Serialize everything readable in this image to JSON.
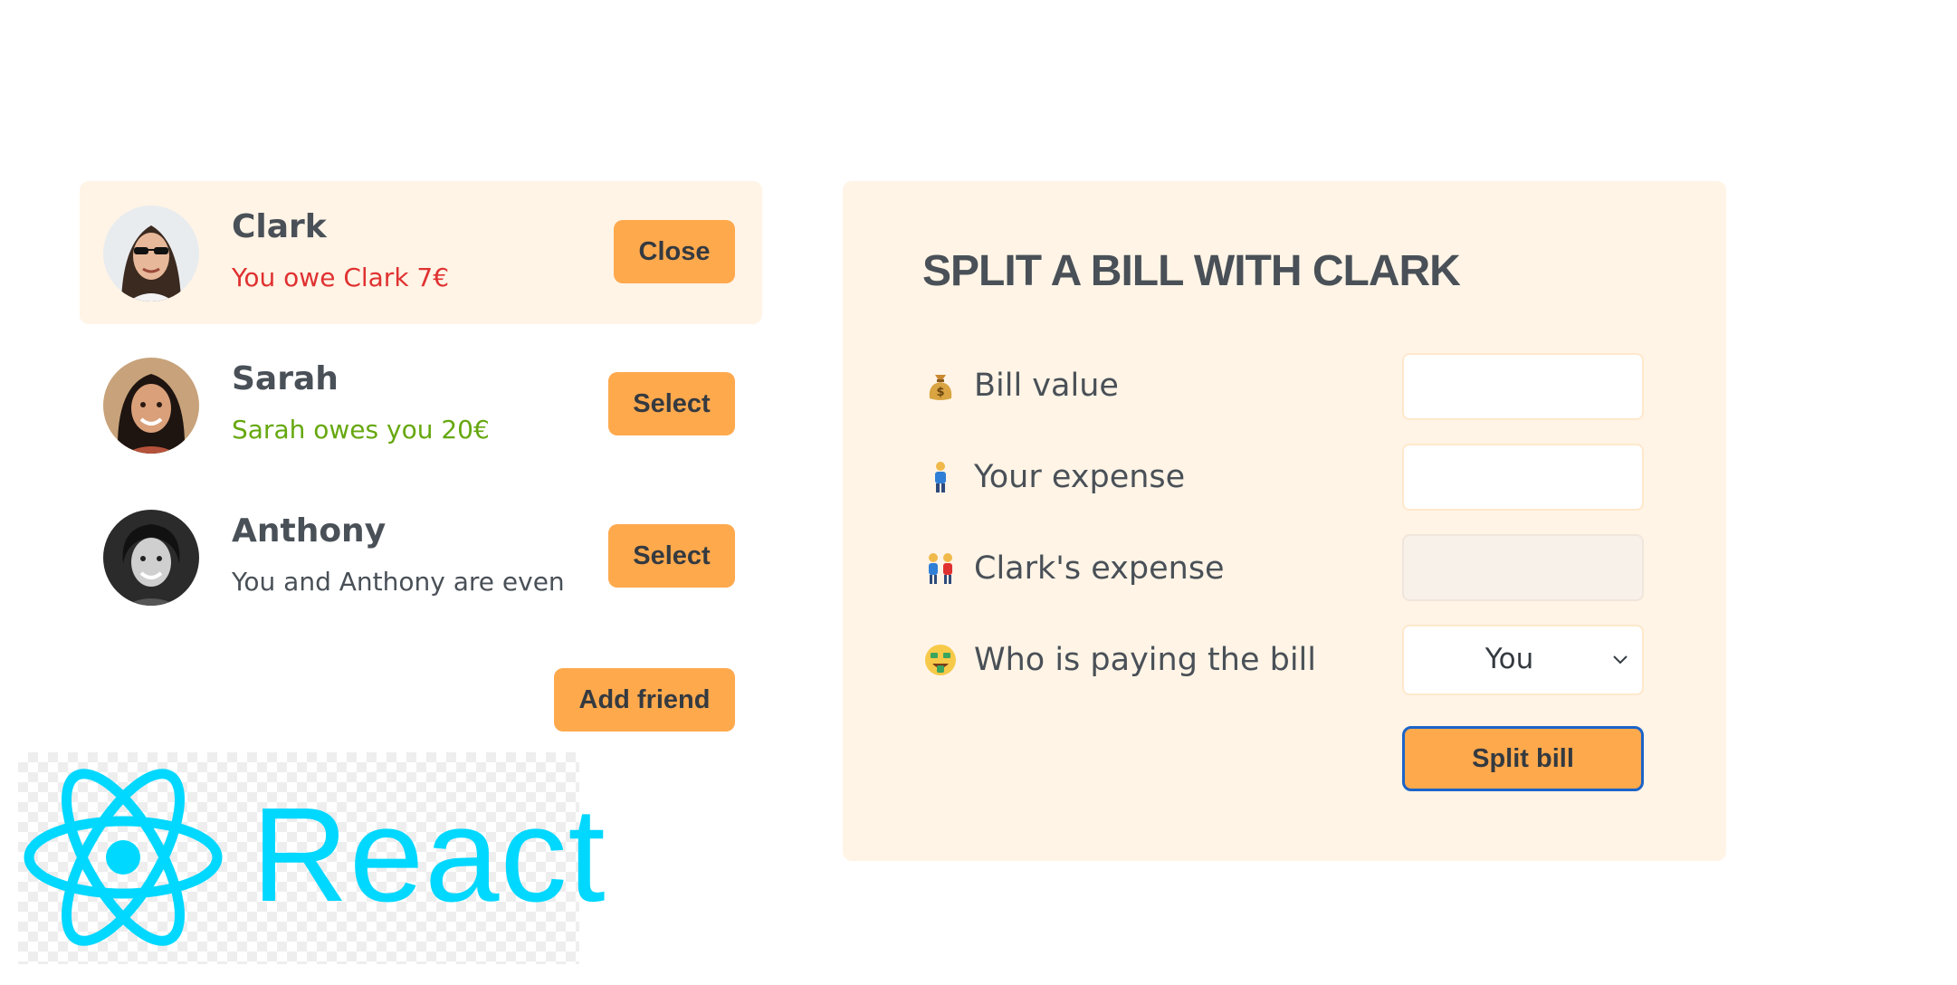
{
  "friends": [
    {
      "name": "Clark",
      "balance_text": "You owe Clark 7€",
      "balance_status": "owe",
      "button_label": "Close",
      "selected": true
    },
    {
      "name": "Sarah",
      "balance_text": "Sarah owes you 20€",
      "balance_status": "owed",
      "button_label": "Select",
      "selected": false
    },
    {
      "name": "Anthony",
      "balance_text": "You and Anthony are even",
      "balance_status": "even",
      "button_label": "Select",
      "selected": false
    }
  ],
  "add_friend_label": "Add friend",
  "form": {
    "title": "SPLIT A BILL WITH CLARK",
    "bill_value_label": "Bill value",
    "bill_value": "",
    "your_expense_label": "Your expense",
    "your_expense": "",
    "friend_expense_label": "Clark's expense",
    "friend_expense": "",
    "payer_label": "Who is paying the bill",
    "payer_selected": "You",
    "submit_label": "Split bill",
    "icons": [
      "money-bag-icon",
      "person-icon",
      "couple-icon",
      "money-mouth-face-icon"
    ]
  },
  "logo": {
    "text": "React",
    "color": "#00d8ff"
  },
  "colors": {
    "accent": "#ffa94d",
    "panel_bg": "#fff4e6",
    "owe_red": "#e03131",
    "owed_green": "#66a80f",
    "focus_ring": "#1c64c8"
  }
}
